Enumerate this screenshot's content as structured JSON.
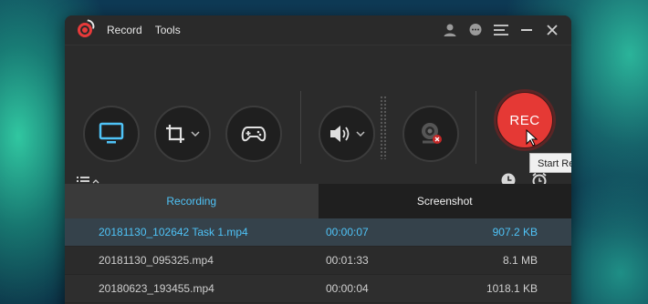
{
  "menu": {
    "record": "Record",
    "tools": "Tools"
  },
  "controls": {
    "rec_label": "REC",
    "tooltip": "Start Recording (Ctrl+Shi"
  },
  "tabs": [
    {
      "label": "Recording",
      "active": true
    },
    {
      "label": "Screenshot",
      "active": false
    }
  ],
  "files": [
    {
      "name": "20181130_102642 Task 1.mp4",
      "duration": "00:00:07",
      "size": "907.2 KB",
      "selected": true
    },
    {
      "name": "20181130_095325.mp4",
      "duration": "00:01:33",
      "size": "8.1 MB",
      "selected": false
    },
    {
      "name": "20180623_193455.mp4",
      "duration": "00:00:04",
      "size": "1018.1 KB",
      "selected": false
    }
  ],
  "icons": {
    "display": "monitor-icon",
    "region": "crop-icon",
    "game": "gamepad-icon",
    "audio": "speaker-icon",
    "webcam": "webcam-icon",
    "list": "list-icon",
    "history": "clock-icon",
    "schedule": "alarm-icon",
    "user": "user-icon",
    "feedback": "chat-icon",
    "menu": "hamburger-icon"
  },
  "colors": {
    "accent": "#4fc3f7",
    "rec": "#e53935",
    "window": "#2b2b2b"
  }
}
